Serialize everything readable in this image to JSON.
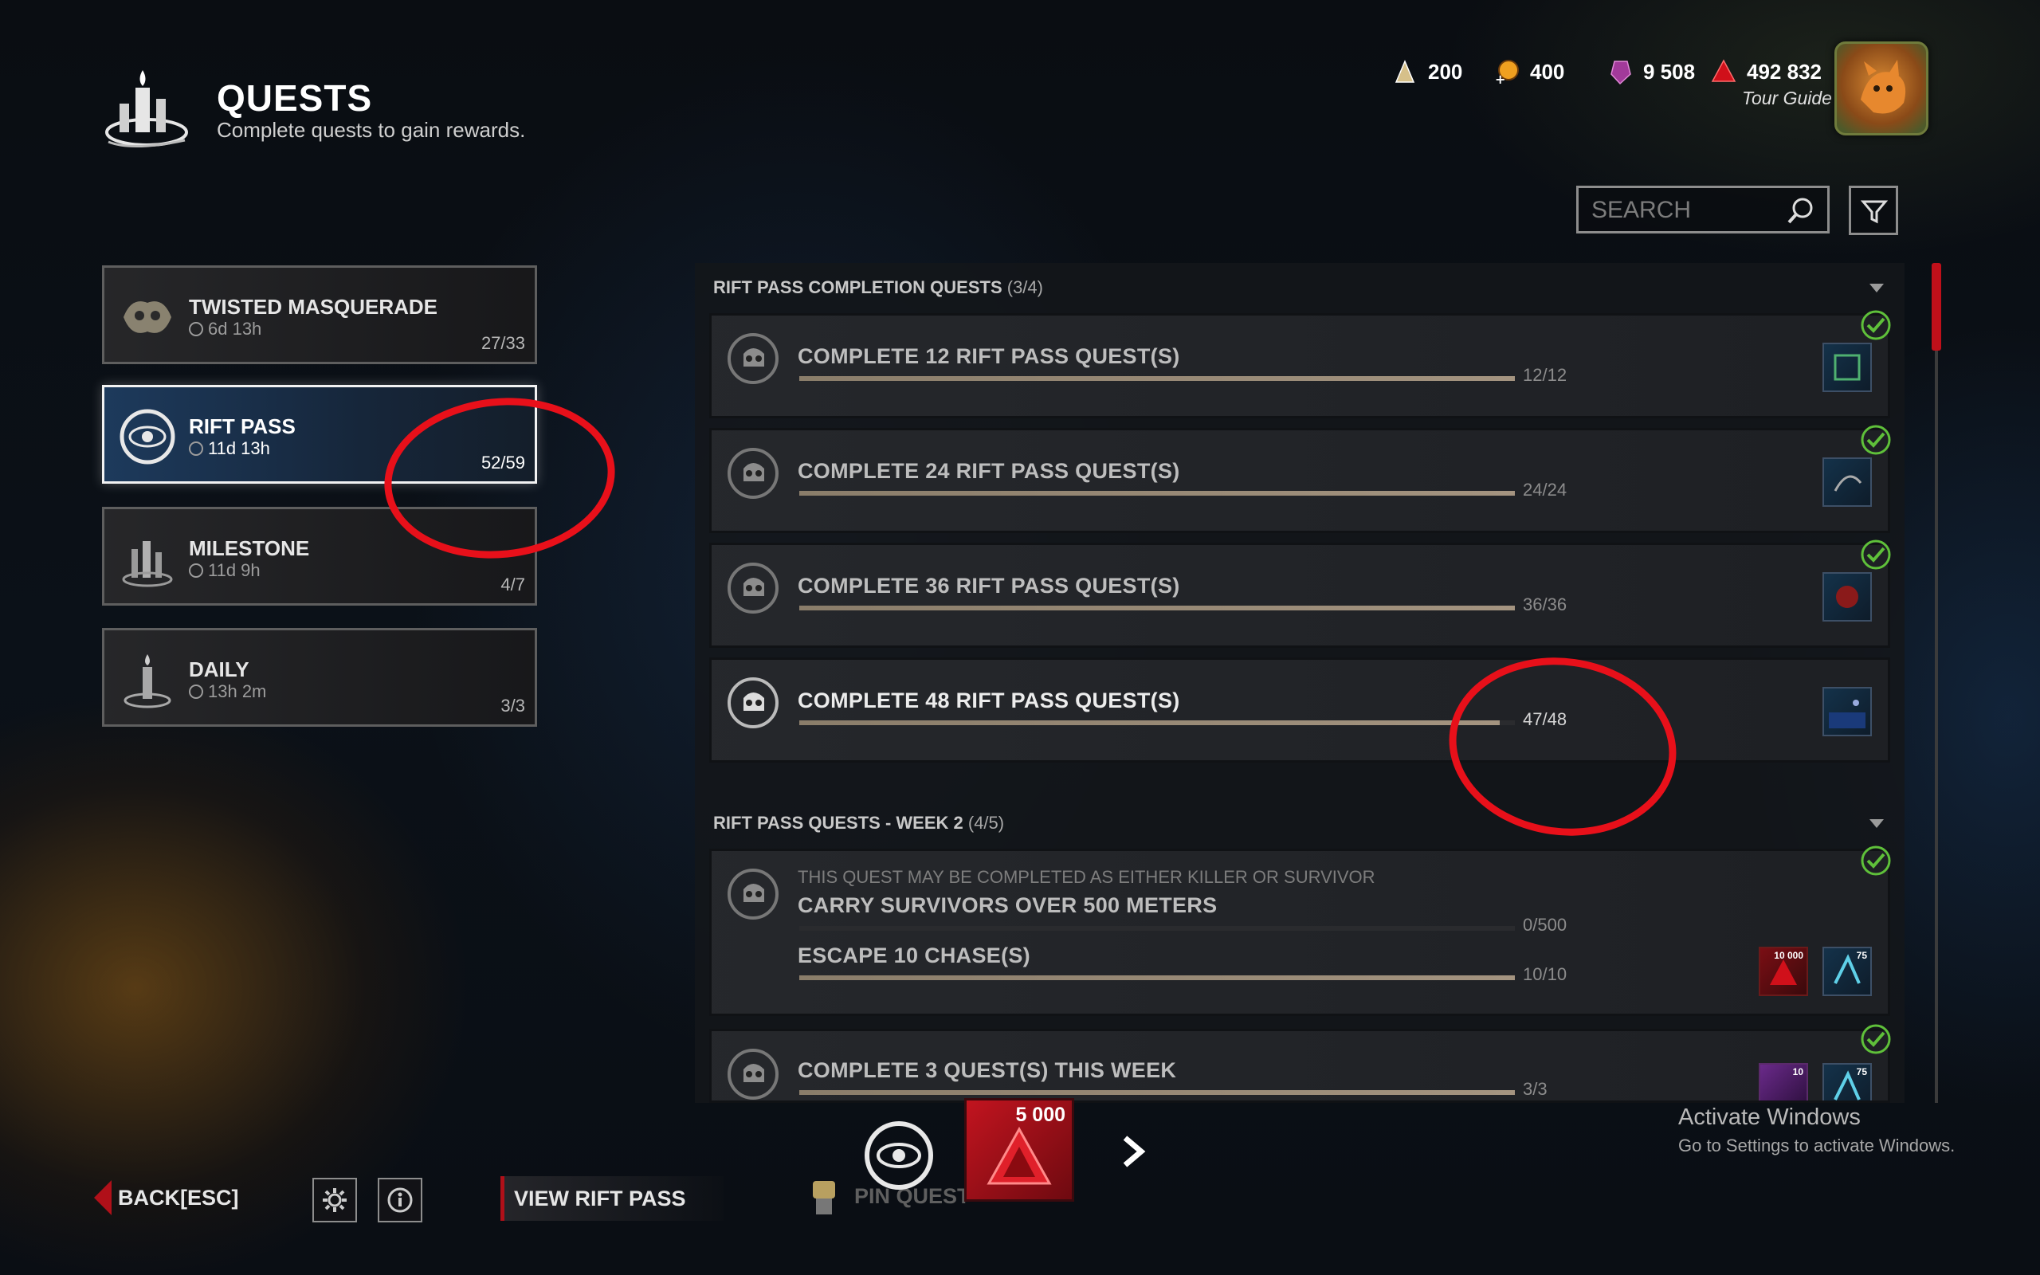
{
  "header": {
    "title": "QUESTS",
    "subtitle": "Complete quests to gain rewards."
  },
  "currencies": [
    {
      "name": "rift-fragments",
      "value": "200",
      "color": "#d6c08a"
    },
    {
      "name": "bloodpoints-bonus",
      "value": "400",
      "color": "#f0a020"
    },
    {
      "name": "auric-cells",
      "value": "9 508",
      "color": "#a23a9a"
    },
    {
      "name": "bloodpoints",
      "value": "492 832",
      "color": "#d0101a"
    }
  ],
  "player": {
    "title": "Tour Guide"
  },
  "search": {
    "placeholder": "SEARCH"
  },
  "categories": [
    {
      "name": "TWISTED MASQUERADE",
      "time": "6d 13h",
      "count": "27/33"
    },
    {
      "name": "RIFT PASS",
      "time": "11d 13h",
      "count": "52/59",
      "selected": true
    },
    {
      "name": "MILESTONE",
      "time": "11d 9h",
      "count": "4/7"
    },
    {
      "name": "DAILY",
      "time": "13h 2m",
      "count": "3/3"
    }
  ],
  "sections": [
    {
      "title": "RIFT PASS COMPLETION QUESTS",
      "count": "(3/4)",
      "quests": [
        {
          "title": "COMPLETE 12 RIFT PASS QUEST(S)",
          "progress": "12/12",
          "fraction": 1.0,
          "done": true
        },
        {
          "title": "COMPLETE 24 RIFT PASS QUEST(S)",
          "progress": "24/24",
          "fraction": 1.0,
          "done": true
        },
        {
          "title": "COMPLETE 36 RIFT PASS QUEST(S)",
          "progress": "36/36",
          "fraction": 1.0,
          "done": true
        },
        {
          "title": "COMPLETE 48 RIFT PASS QUEST(S)",
          "progress": "47/48",
          "fraction": 0.979,
          "done": false
        }
      ]
    },
    {
      "title": "RIFT PASS QUESTS - WEEK 2",
      "count": "(4/5)",
      "quests": [
        {
          "note": "THIS QUEST MAY BE COMPLETED AS EITHER KILLER OR SURVIVOR",
          "title": "CARRY SURVIVORS OVER 500 METERS",
          "progress": "0/500",
          "fraction": 0.0,
          "title2": "ESCAPE 10 CHASE(S)",
          "progress2": "10/10",
          "fraction2": 1.0,
          "reward1": "10 000",
          "reward2": "75",
          "done": true
        },
        {
          "title": "COMPLETE 3 QUEST(S) THIS WEEK",
          "progress": "3/3",
          "fraction": 1.0,
          "reward1": "10",
          "reward2": "75",
          "done": true
        }
      ]
    }
  ],
  "bottom": {
    "back_label": "BACK",
    "back_key": "[ESC]",
    "view_rift_pass": "VIEW RIFT PASS",
    "pin_label": "PIN QUEST",
    "reward_value": "5 000"
  },
  "activate": {
    "line1": "Activate Windows",
    "line2": "Go to Settings to activate Windows."
  },
  "accent_color": "#b01019"
}
